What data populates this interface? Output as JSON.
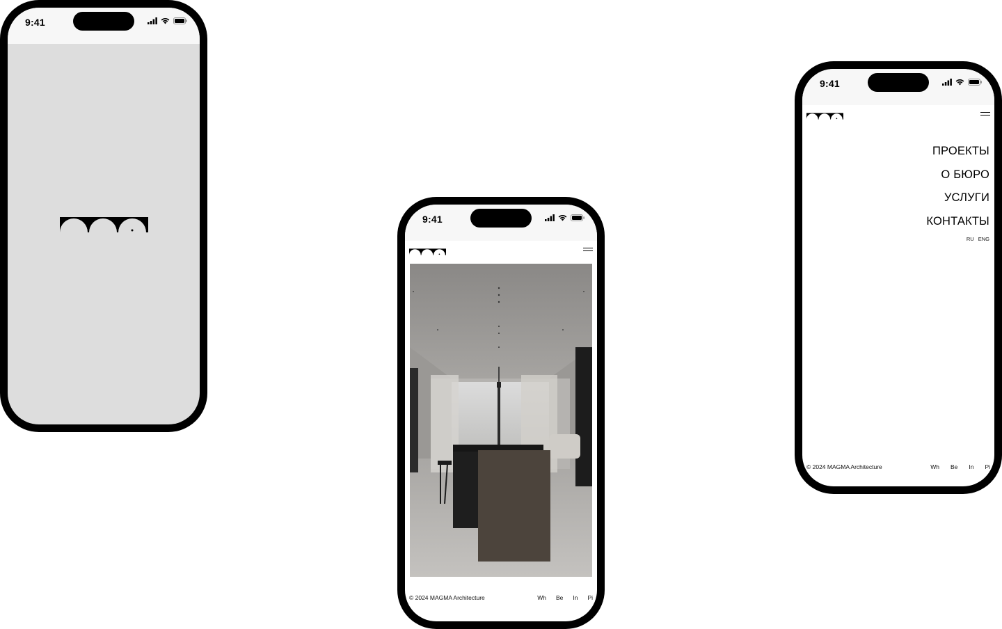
{
  "status_bar": {
    "time": "9:41"
  },
  "brand": {
    "logo_icon": "magma-arches-logo"
  },
  "site": {
    "menu_icon": "hamburger-icon",
    "hero_image": "interior-kitchen-photo",
    "copyright": "© 2024 MAGMA  Architecture",
    "socials": [
      "Wh",
      "Be",
      "In",
      "Pi"
    ]
  },
  "menu": {
    "items": [
      "ПРОЕКТЫ",
      "О БЮРО",
      "УСЛУГИ",
      "КОНТАКТЫ"
    ],
    "languages": [
      "RU",
      "ENG"
    ]
  },
  "colors": {
    "splash_bg": "#dddddd",
    "status_bg": "#f7f7f7",
    "frame": "#000000"
  }
}
